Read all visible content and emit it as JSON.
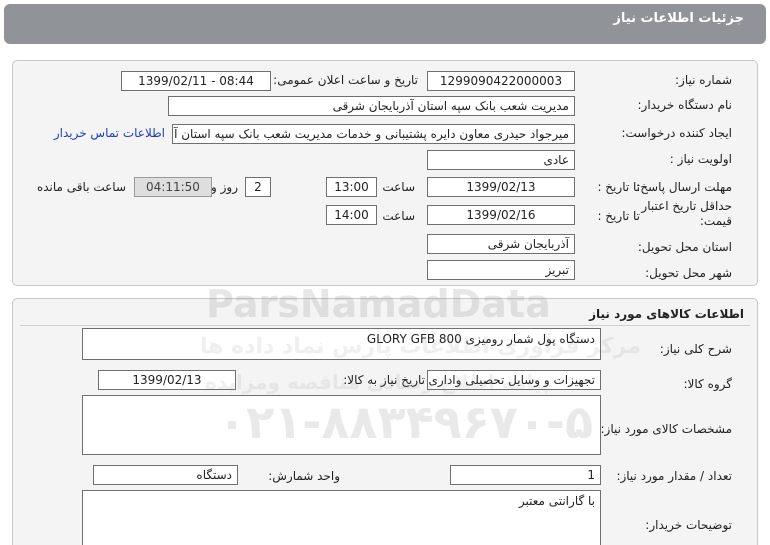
{
  "header": {
    "title": "جزئیات اطلاعات نیاز"
  },
  "need_info": {
    "need_number_label": "شماره نیاز:",
    "need_number": "1299090422000003",
    "announce_label": "تاریخ و ساعت اعلان عمومی:",
    "announce_value": "1399/02/11 - 08:44",
    "buyer_org_label": "نام دستگاه خریدار:",
    "buyer_org": "مدیریت شعب بانک سپه استان آذربایجان شرقی",
    "creator_label": "ایجاد کننده درخواست:",
    "creator": "میرجواد حیدری معاون دایره پشتیبانی و خدمات مدیریت شعب بانک سپه استان آ",
    "contact_link": "اطلاعات تماس خریدار",
    "priority_label": "اولویت نیاز :",
    "priority": "عادی",
    "response_deadline_label": "مهلت ارسال پاسخ:",
    "to_date_label": "تا تاریخ :",
    "response_date": "1399/02/13",
    "time_label": "ساعت",
    "response_time": "13:00",
    "days_value": "2",
    "days_label": "روز و",
    "remaining_time": "04:11:50",
    "remaining_label": "ساعت باقی مانده",
    "price_validity_label_1": "حداقل تاریخ اعتبار",
    "price_validity_label_2": "قیمت:",
    "validity_date": "1399/02/16",
    "validity_time": "14:00",
    "delivery_province_label": "استان محل تحویل:",
    "delivery_province": "آذربایجان شرقی",
    "delivery_city_label": "شهر محل تحویل:",
    "delivery_city": "تبریز"
  },
  "goods": {
    "section_title": "اطلاعات کالاهای مورد نیاز",
    "general_desc_label": "شرح کلی نیاز:",
    "general_desc": "دستگاه پول شمار رومیزی GLORY GFB 800",
    "group_label": "گروه کالا:",
    "group": "تجهیزات و وسایل تحصیلی واداری",
    "need_date_label": "تاریخ نیاز به کالا:",
    "need_date": "1399/02/13",
    "specs_label": "مشخصات کالای مورد نیاز:",
    "specs": "",
    "quantity_label": "تعداد / مقدار مورد نیاز:",
    "quantity": "1",
    "unit_label": "واحد شمارش:",
    "unit": "دستگاه",
    "buyer_notes_label": "توضیحات خریدار:",
    "buyer_notes": "با گارانتی معتبر"
  },
  "watermark": {
    "brand": "ParsNamadData",
    "persian_line_1": "مرکز فرآوری اطلاعات پارس نماد داده ها",
    "persian_line_2": "پیامه اطلاع رسانی مناقصه ومزایده",
    "phone": "۰۲۱-۸۸۳۴۹۶۷۰-۵"
  }
}
